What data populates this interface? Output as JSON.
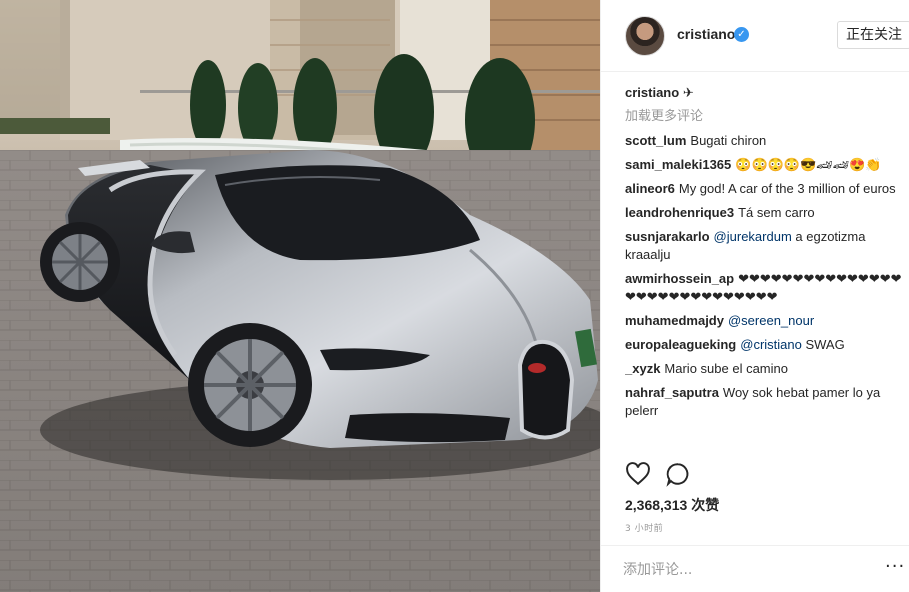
{
  "post": {
    "image_alt": "Silver Bugatti Chiron parked on a brick driveway in front of a modern house",
    "owner": {
      "username": "cristiano",
      "verified_icon": "verified-badge-icon",
      "follow_label": "正在关注"
    },
    "caption": {
      "username": "cristiano",
      "text": "✈"
    },
    "load_more_label": "加载更多评论",
    "comments": [
      {
        "user": "scott_lum",
        "text": "Bugati chiron"
      },
      {
        "user": "sami_maleki1365",
        "text": "😳😳😳😳😎🏎🏎😍👏"
      },
      {
        "user": "alineor6",
        "text": "My god! A car of the 3 million of euros"
      },
      {
        "user": "leandrohenrique3",
        "text": "Tá sem carro"
      },
      {
        "user": "susnjarakarlo",
        "mention": "@jurekardum",
        "text": " a egzotizma kraaalju"
      },
      {
        "user": "awmirhossein_ap",
        "text": "❤❤❤❤❤❤❤❤❤❤❤❤❤❤❤❤❤❤❤❤❤❤❤❤❤❤❤❤❤"
      },
      {
        "user": "muhamedmajdy",
        "mention": "@sereen_nour",
        "text": ""
      },
      {
        "user": "europaleagueking",
        "mention": "@cristiano",
        "text": " SWAG"
      },
      {
        "user": "_xyzk",
        "text": "Mario sube el camino"
      },
      {
        "user": "nahraf_saputra",
        "text": "Woy sok hebat pamer lo ya pelerr"
      }
    ],
    "likes_count": "2,368,313",
    "likes_suffix": "次赞",
    "time_ago": "3 小时前",
    "add_comment_placeholder": "添加评论...",
    "more_options_label": "···",
    "colors": {
      "accent": "#3897f0",
      "border": "#efefef",
      "muted": "#999999",
      "text": "#262626"
    }
  }
}
